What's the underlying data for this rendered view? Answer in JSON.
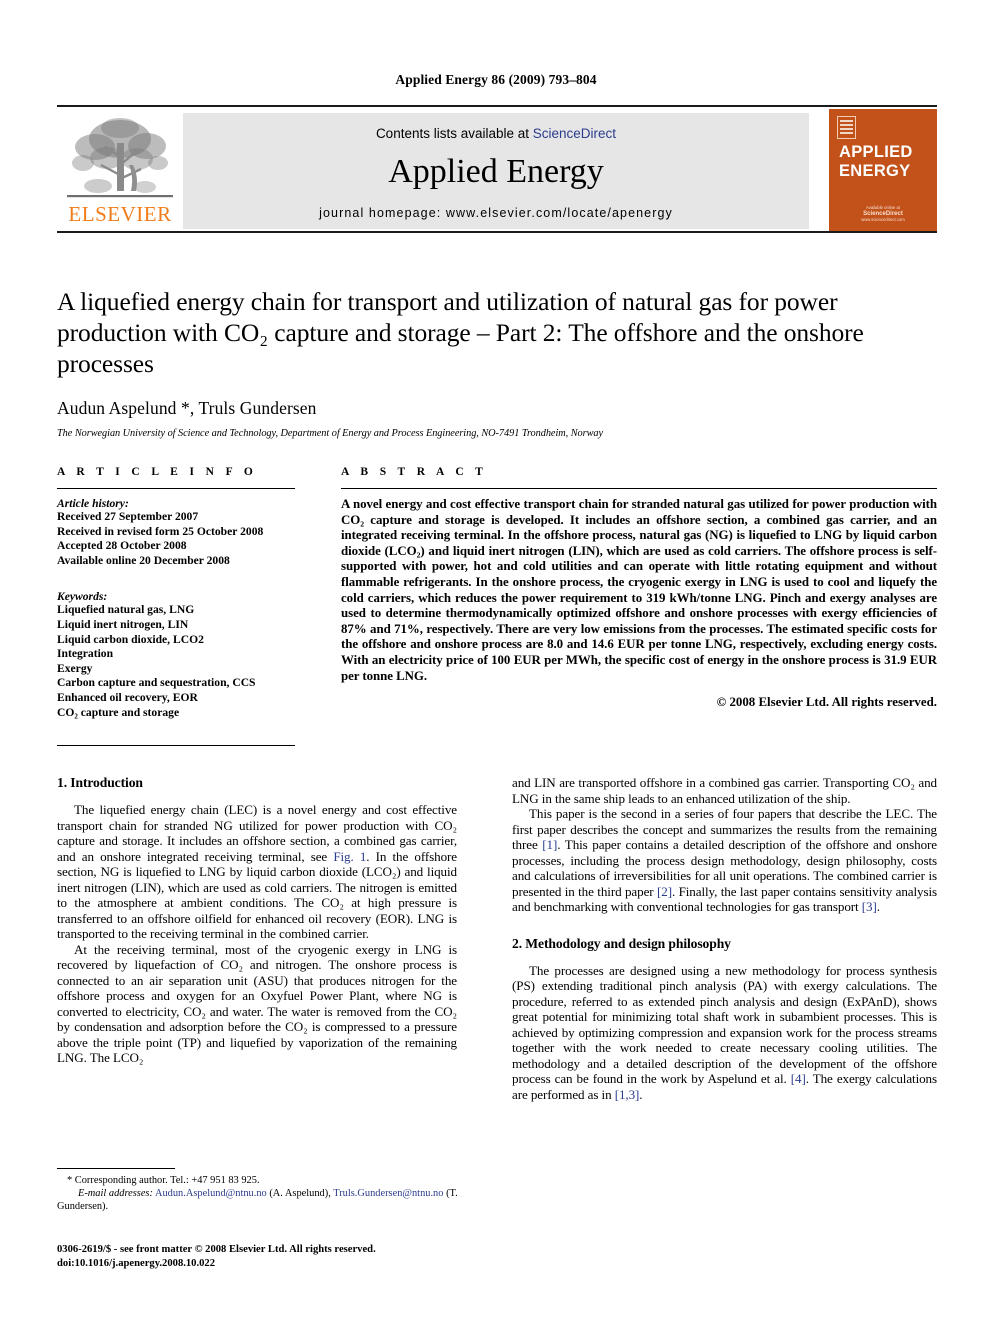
{
  "running_head": "Applied Energy 86 (2009) 793–804",
  "masthead": {
    "publisher_name": "ELSEVIER",
    "contents_prefix": "Contents lists available at ",
    "sciencedirect": "ScienceDirect",
    "journal_title": "Applied Energy",
    "homepage": "journal homepage: www.elsevier.com/locate/apenergy",
    "cover": {
      "line1": "APPLIED",
      "line2": "ENERGY",
      "foot_top": "Available online at",
      "foot_brand": "ScienceDirect",
      "foot_url": "www.sciencedirect.com"
    },
    "accent_orange": "#C2511A",
    "logo_orange": "#F07D1A",
    "link_blue": "#2b3c8c"
  },
  "article": {
    "title": "A liquefied energy chain for transport and utilization of natural gas for power production with CO₂ capture and storage – Part 2: The offshore and the onshore processes",
    "authors": "Audun Aspelund *, Truls Gundersen",
    "affiliation": "The Norwegian University of Science and Technology, Department of Energy and Process Engineering, NO-7491 Trondheim, Norway"
  },
  "info": {
    "heading": "A R T I C L E  I N F O",
    "history_label": "Article history:",
    "history": [
      "Received 27 September 2007",
      "Received in revised form 25 October 2008",
      "Accepted 28 October 2008",
      "Available online 20 December 2008"
    ],
    "keywords_label": "Keywords:",
    "keywords": [
      "Liquefied natural gas, LNG",
      "Liquid inert nitrogen, LIN",
      "Liquid carbon dioxide, LCO2",
      "Integration",
      "Exergy",
      "Carbon capture and sequestration, CCS",
      "Enhanced oil recovery, EOR",
      "CO₂ capture and storage"
    ]
  },
  "abstract": {
    "heading": "A B S T R A C T",
    "text": "A novel energy and cost effective transport chain for stranded natural gas utilized for power production with CO₂ capture and storage is developed. It includes an offshore section, a combined gas carrier, and an integrated receiving terminal. In the offshore process, natural gas (NG) is liquefied to LNG by liquid carbon dioxide (LCO₂) and liquid inert nitrogen (LIN), which are used as cold carriers. The offshore process is self-supported with power, hot and cold utilities and can operate with little rotating equipment and without flammable refrigerants. In the onshore process, the cryogenic exergy in LNG is used to cool and liquefy the cold carriers, which reduces the power requirement to 319 kWh/tonne LNG. Pinch and exergy analyses are used to determine thermodynamically optimized offshore and onshore processes with exergy efficiencies of 87% and 71%, respectively. There are very low emissions from the processes. The estimated specific costs for the offshore and onshore process are 8.0 and 14.6 EUR per tonne LNG, respectively, excluding energy costs. With an electricity price of 100 EUR per MWh, the specific cost of energy in the onshore process is 31.9 EUR per tonne LNG.",
    "copyright": "© 2008 Elsevier Ltd. All rights reserved."
  },
  "sections": {
    "introduction_heading": "1. Introduction",
    "methodology_heading": "2. Methodology and design philosophy"
  },
  "body": {
    "intro_p1_a": "The liquefied energy chain (LEC) is a novel energy and cost effective transport chain for stranded NG utilized for power production with CO₂ capture and storage. It includes an offshore section, a combined gas carrier, and an onshore integrated receiving terminal, see ",
    "intro_p1_fig": "Fig. 1",
    "intro_p1_b": ". In the offshore section, NG is liquefied to LNG by liquid carbon dioxide (LCO₂) and liquid inert nitrogen (LIN), which are used as cold carriers. The nitrogen is emitted to the atmosphere at ambient conditions. The CO₂ at high pressure is transferred to an offshore oilfield for enhanced oil recovery (EOR). LNG is transported to the receiving terminal in the combined carrier.",
    "intro_p2": "At the receiving terminal, most of the cryogenic exergy in LNG is recovered by liquefaction of CO₂ and nitrogen. The onshore process is connected to an air separation unit (ASU) that produces nitrogen for the offshore process and oxygen for an Oxyfuel Power Plant, where NG is converted to electricity, CO₂ and water. The water is removed from the CO₂ by condensation and adsorption before the CO₂ is compressed to a pressure above the triple point (TP) and liquefied by vaporization of the remaining LNG. The LCO₂",
    "right_p1": "and LIN are transported offshore in a combined gas carrier. Transporting CO₂ and LNG in the same ship leads to an enhanced utilization of the ship.",
    "right_p2_a": "This paper is the second in a series of four papers that describe the LEC. The first paper describes the concept and summarizes the results from the remaining three ",
    "right_p2_ref1": "[1]",
    "right_p2_b": ". This paper contains a detailed description of the offshore and onshore processes, including the process design methodology, design philosophy, costs and calculations of irreversibilities for all unit operations. The combined carrier is presented in the third paper ",
    "right_p2_ref2": "[2]",
    "right_p2_c": ". Finally, the last paper contains sensitivity analysis and benchmarking with conventional technologies for gas transport ",
    "right_p2_ref3": "[3]",
    "right_p2_d": ".",
    "method_p1_a": "The processes are designed using a new methodology for process synthesis (PS) extending traditional pinch analysis (PA) with exergy calculations. The procedure, referred to as extended pinch analysis and design (ExPAnD), shows great potential for minimizing total shaft work in subambient processes. This is achieved by optimizing compression and expansion work for the process streams together with the work needed to create necessary cooling utilities. The methodology and a detailed description of the development of the offshore process can be found in the work by Aspelund et al. ",
    "method_p1_ref1": "[4]",
    "method_p1_b": ". The exergy calculations are performed as in ",
    "method_p1_ref2": "[1,3]",
    "method_p1_c": "."
  },
  "footnotes": {
    "corresponding": "Corresponding author. Tel.: +47 951 83 925.",
    "email_label": "E-mail addresses:",
    "email1": "Audun.Aspelund@ntnu.no",
    "email1_name": "(A. Aspelund),",
    "email2": "Truls.Gundersen@",
    "email2_cont": "ntnu.no",
    "email2_name": "(T. Gundersen).",
    "issn_line": "0306-2619/$ - see front matter © 2008 Elsevier Ltd. All rights reserved.",
    "doi_line": "doi:10.1016/j.apenergy.2008.10.022"
  }
}
